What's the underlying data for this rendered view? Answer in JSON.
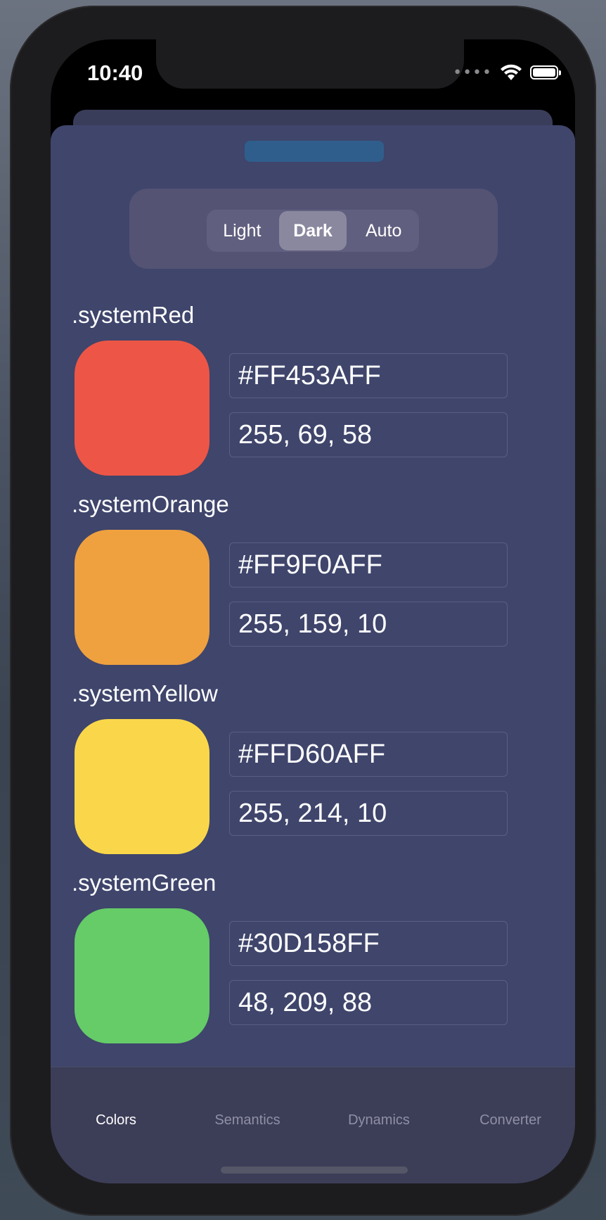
{
  "status_bar": {
    "time": "10:40",
    "signal_icon": "signal-dots-icon",
    "wifi_icon": "wifi-icon",
    "battery_icon": "battery-icon"
  },
  "appearance_control": {
    "options": [
      "Light",
      "Dark",
      "Auto"
    ],
    "selected": "Dark"
  },
  "colors": [
    {
      "name": ".systemRed",
      "hex": "#FF453AFF",
      "rgb": "255, 69, 58",
      "swatch": "#ed5646"
    },
    {
      "name": ".systemOrange",
      "hex": "#FF9F0AFF",
      "rgb": "255, 159, 10",
      "swatch": "#efa13f"
    },
    {
      "name": ".systemYellow",
      "hex": "#FFD60AFF",
      "rgb": "255, 214, 10",
      "swatch": "#fad74a"
    },
    {
      "name": ".systemGreen",
      "hex": "#30D158FF",
      "rgb": "48, 209, 88",
      "swatch": "#65cc68"
    }
  ],
  "tab_bar": {
    "tabs": [
      "Colors",
      "Semantics",
      "Dynamics",
      "Converter"
    ],
    "active": "Colors"
  },
  "theme": {
    "sheet_background": "#3f456b",
    "tab_bar_background": "#3c3d57"
  }
}
